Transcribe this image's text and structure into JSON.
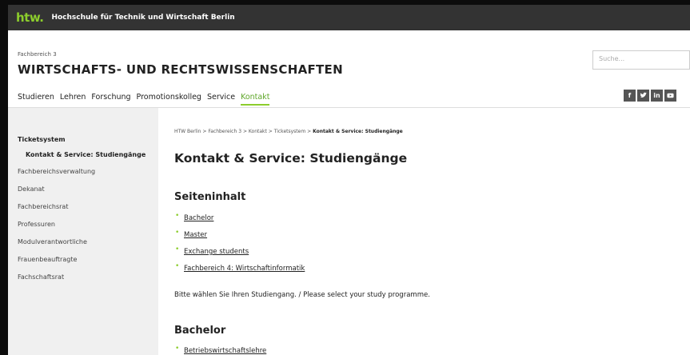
{
  "site": {
    "logo": "htw.",
    "university": "Hochschule für Technik und Wirtschaft Berlin"
  },
  "header": {
    "fb_small": "Fachbereich 3",
    "fb_title": "WIRTSCHAFTS- UND RECHTSWISSENSCHAFTEN",
    "search_placeholder": "Suche...",
    "nav": [
      "Studieren",
      "Lehren",
      "Forschung",
      "Promotionskolleg",
      "Service",
      "Kontakt"
    ],
    "nav_active": "Kontakt",
    "social": [
      "f",
      "t",
      "in",
      "yt"
    ]
  },
  "sidebar": {
    "items": [
      {
        "label": "Ticketsystem"
      },
      {
        "label": "Kontakt & Service: Studiengänge"
      },
      {
        "label": "Fachbereichsverwaltung"
      },
      {
        "label": "Dekanat"
      },
      {
        "label": "Fachbereichsrat"
      },
      {
        "label": "Professuren"
      },
      {
        "label": "Modulverantwortliche"
      },
      {
        "label": "Frauenbeauftragte"
      },
      {
        "label": "Fachschaftsrat"
      }
    ]
  },
  "breadcrumb": {
    "items": [
      "HTW Berlin",
      "Fachbereich 3",
      "Kontakt",
      "Ticketsystem"
    ],
    "current": "Kontakt & Service: Studiengänge",
    "separator": ">"
  },
  "main": {
    "title": "Kontakt & Service: Studiengänge",
    "toc_heading": "Seiteninhalt",
    "toc": [
      "Bachelor",
      "Master",
      "Exchange students",
      "Fachbereich 4: Wirtschaftinformatik"
    ],
    "intro": "Bitte wählen Sie Ihren Studiengang. / Please select your study programme.",
    "section_heading": "Bachelor",
    "section_items": [
      "Betriebswirtschaftslehre"
    ]
  },
  "colors": {
    "accent": "#8ccd2c",
    "topbar": "#333333",
    "sidebar": "#f0f0f0"
  }
}
